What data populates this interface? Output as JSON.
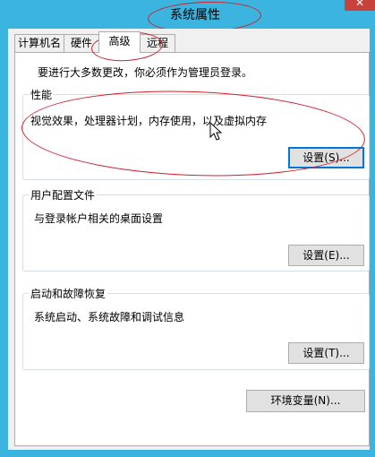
{
  "window": {
    "title": "系统属性",
    "close_icon": "close-icon"
  },
  "tabs": [
    {
      "label": "计算机名",
      "active": false
    },
    {
      "label": "硬件",
      "active": false
    },
    {
      "label": "高级",
      "active": true
    },
    {
      "label": "远程",
      "active": false
    }
  ],
  "admin_notice": "要进行大多数更改，你必须作为管理员登录。",
  "performance": {
    "label": "性能",
    "description": "视觉效果，处理器计划，内存使用，以及虚拟内存",
    "button": "设置(S)..."
  },
  "user_profiles": {
    "label": "用户配置文件",
    "description": "与登录帐户相关的桌面设置",
    "button": "设置(E)..."
  },
  "startup_recovery": {
    "label": "启动和故障恢复",
    "description": "系统启动、系统故障和调试信息",
    "button": "设置(T)..."
  },
  "env_button": "环境变量(N)...",
  "colors": {
    "titlebar": "#3bb4e0",
    "close": "#c7423a",
    "annotation": "#d0202a",
    "focus": "#0078d7"
  }
}
